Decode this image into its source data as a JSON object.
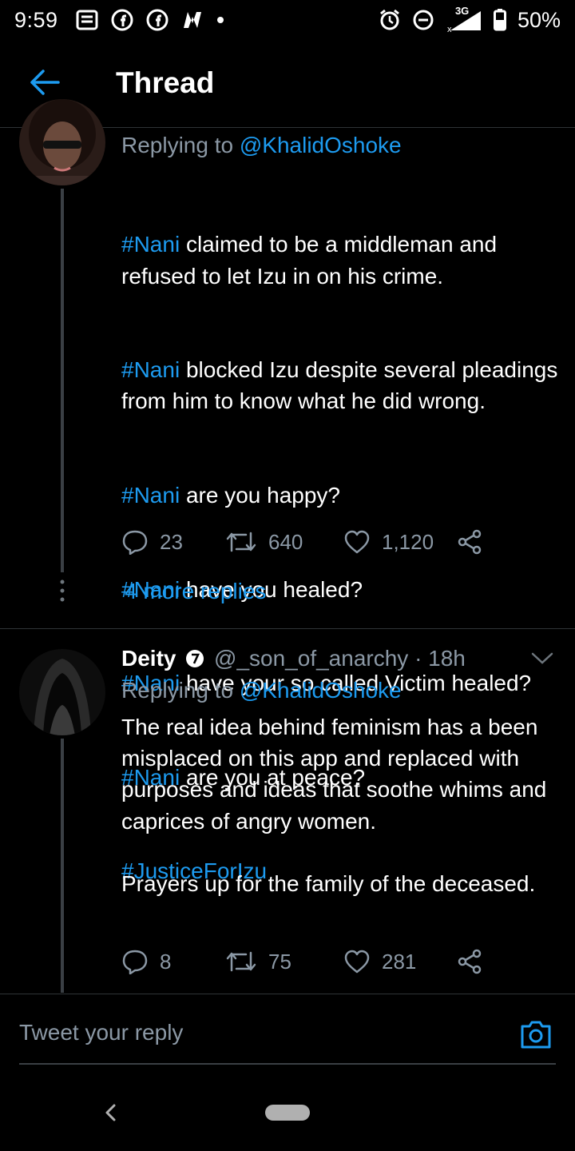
{
  "status_bar": {
    "time": "9:59",
    "network": "3G",
    "battery": "50%"
  },
  "header": {
    "title": "Thread"
  },
  "tweets": [
    {
      "reply_prefix": "Replying to ",
      "reply_to": "@KhalidOshoke",
      "body_lines": [
        {
          "tag": "#Nani",
          "text": " claimed to be a middleman and refused to let Izu in on his crime."
        },
        {
          "tag": "#Nani",
          "text": " blocked Izu despite several pleadings from him to know what he did wrong."
        },
        {
          "tag": "#Nani",
          "text": " are you happy?"
        },
        {
          "tag": "#Nani",
          "text": " have you healed?"
        },
        {
          "tag": "#Nani",
          "text": " have your so called Victim healed?"
        },
        {
          "tag": "#Nani",
          "text": " are you at peace?"
        },
        {
          "tag": "#JusticeForIzu",
          "text": ""
        }
      ],
      "replies": "23",
      "retweets": "640",
      "likes": "1,120",
      "more_replies": "4 more replies"
    },
    {
      "name": "Deity",
      "handle": "@_son_of_anarchy",
      "time": "· 18h",
      "reply_prefix": "Replying to ",
      "reply_to": "@KhalidOshoke",
      "body": "The real idea behind feminism has a been misplaced on this app and replaced with purposes and ideas that soothe whims and caprices of angry women.\n\nPrayers up for the family of the deceased.",
      "replies": "8",
      "retweets": "75",
      "likes": "281"
    }
  ],
  "composer": {
    "placeholder": "Tweet your reply"
  },
  "colors": {
    "accent": "#1d9bf0",
    "secondary_text": "#8b98a5",
    "background": "#000000",
    "divider": "#2f3336"
  }
}
